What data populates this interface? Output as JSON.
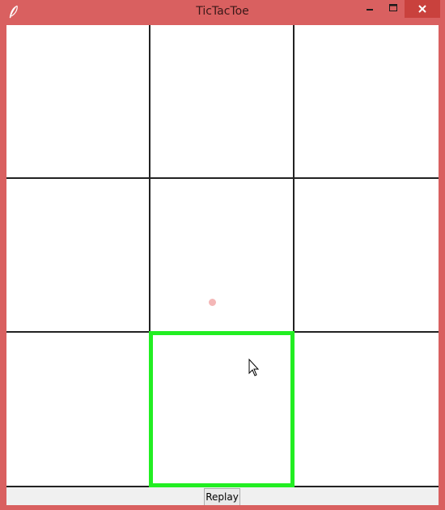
{
  "window": {
    "title": "TicTacToe",
    "frame_color": "#d96060",
    "close_button_color": "#c9413d",
    "app_icon": "feather-icon"
  },
  "board": {
    "rows": 3,
    "columns": 3,
    "cells": [
      "",
      "",
      "",
      "",
      "",
      "",
      "",
      "",
      ""
    ],
    "highlight_color": "#22ee22",
    "highlighted_cell": "row 3, column 2"
  },
  "controls": {
    "replay_label": "Replay"
  }
}
